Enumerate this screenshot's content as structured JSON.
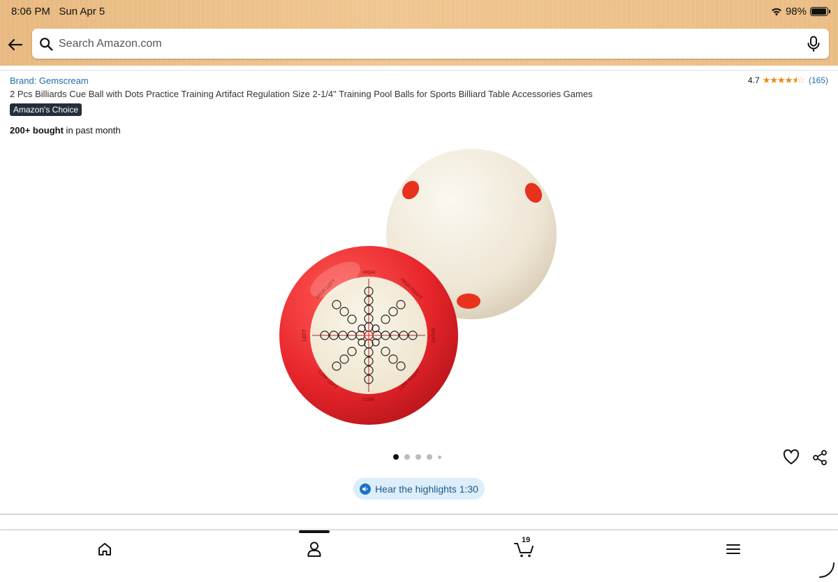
{
  "status_bar": {
    "time": "8:06 PM",
    "date": "Sun Apr 5",
    "battery": "98%"
  },
  "search": {
    "placeholder": "Search Amazon.com"
  },
  "product": {
    "brand": "Brand: Gemscream",
    "rating": "4.7",
    "rating_stars": 4.7,
    "review_count": "(165)",
    "title": "2 Pcs Billiards Cue Ball with Dots Practice Training Artifact Regulation Size 2-1/4\" Training Pool Balls for Sports Billiard Table Accessories Games",
    "badge": "Amazon's Choice",
    "bought_bold": "200+ bought",
    "bought_rest": " in past month",
    "image_labels": [
      "HIGH",
      "HIGH RIGHT",
      "RIGHT",
      "LOW RIGHT",
      "LOW",
      "LOW LEFT",
      "LEFT",
      "HIGH LEFT"
    ]
  },
  "carousel": {
    "count": 5,
    "active": 1
  },
  "audio": {
    "label": "Hear the highlights 1:30"
  },
  "tabbar": {
    "cart_count": "19"
  },
  "colors": {
    "header": "#ebbd85",
    "link": "#1d6fa5",
    "star": "#f08804",
    "badge": "#232f3e",
    "ball_red": "#e8262b",
    "ball_white": "#f3ede0"
  },
  "icons": [
    "back-arrow-icon",
    "search-icon",
    "mic-icon",
    "heart-icon",
    "share-icon",
    "speaker-icon",
    "home-icon",
    "account-icon",
    "cart-icon",
    "menu-icon",
    "wifi-icon",
    "battery-icon"
  ]
}
